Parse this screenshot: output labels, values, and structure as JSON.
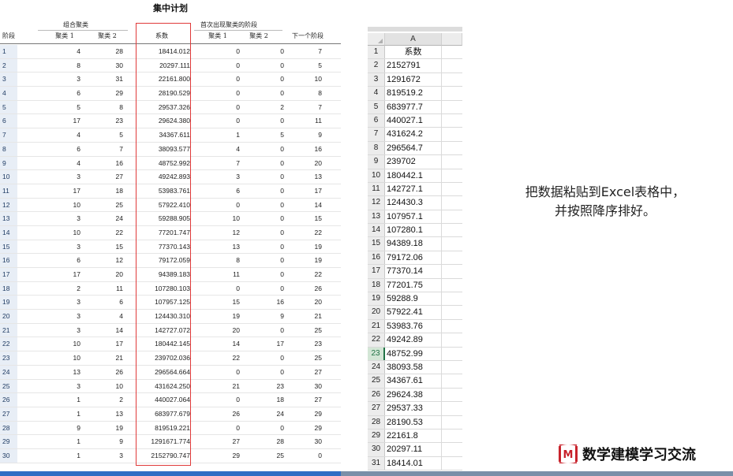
{
  "spss": {
    "title": "集中计划",
    "group_combined": "组合聚类",
    "group_first_appear": "首次出现聚类的阶段",
    "headers": {
      "stage": "阶段",
      "cluster1": "聚类 1",
      "cluster2": "聚类 2",
      "coefficient": "系数",
      "first_cluster1": "聚类 1",
      "first_cluster2": "聚类 2",
      "next_stage": "下一个阶段"
    },
    "rows": [
      [
        "1",
        "4",
        "28",
        "18414.012",
        "0",
        "0",
        "7"
      ],
      [
        "2",
        "8",
        "30",
        "20297.111",
        "0",
        "0",
        "5"
      ],
      [
        "3",
        "3",
        "31",
        "22161.800",
        "0",
        "0",
        "10"
      ],
      [
        "4",
        "6",
        "29",
        "28190.529",
        "0",
        "0",
        "8"
      ],
      [
        "5",
        "5",
        "8",
        "29537.326",
        "0",
        "2",
        "7"
      ],
      [
        "6",
        "17",
        "23",
        "29624.380",
        "0",
        "0",
        "11"
      ],
      [
        "7",
        "4",
        "5",
        "34367.611",
        "1",
        "5",
        "9"
      ],
      [
        "8",
        "6",
        "7",
        "38093.577",
        "4",
        "0",
        "16"
      ],
      [
        "9",
        "4",
        "16",
        "48752.992",
        "7",
        "0",
        "20"
      ],
      [
        "10",
        "3",
        "27",
        "49242.893",
        "3",
        "0",
        "13"
      ],
      [
        "11",
        "17",
        "18",
        "53983.761",
        "6",
        "0",
        "17"
      ],
      [
        "12",
        "10",
        "25",
        "57922.410",
        "0",
        "0",
        "14"
      ],
      [
        "13",
        "3",
        "24",
        "59288.905",
        "10",
        "0",
        "15"
      ],
      [
        "14",
        "10",
        "22",
        "77201.747",
        "12",
        "0",
        "22"
      ],
      [
        "15",
        "3",
        "15",
        "77370.143",
        "13",
        "0",
        "19"
      ],
      [
        "16",
        "6",
        "12",
        "79172.059",
        "8",
        "0",
        "19"
      ],
      [
        "17",
        "17",
        "20",
        "94389.183",
        "11",
        "0",
        "22"
      ],
      [
        "18",
        "2",
        "11",
        "107280.103",
        "0",
        "0",
        "26"
      ],
      [
        "19",
        "3",
        "6",
        "107957.125",
        "15",
        "16",
        "20"
      ],
      [
        "20",
        "3",
        "4",
        "124430.310",
        "19",
        "9",
        "21"
      ],
      [
        "21",
        "3",
        "14",
        "142727.072",
        "20",
        "0",
        "25"
      ],
      [
        "22",
        "10",
        "17",
        "180442.145",
        "14",
        "17",
        "23"
      ],
      [
        "23",
        "10",
        "21",
        "239702.036",
        "22",
        "0",
        "25"
      ],
      [
        "24",
        "13",
        "26",
        "296564.664",
        "0",
        "0",
        "27"
      ],
      [
        "25",
        "3",
        "10",
        "431624.250",
        "21",
        "23",
        "30"
      ],
      [
        "26",
        "1",
        "2",
        "440027.064",
        "0",
        "18",
        "27"
      ],
      [
        "27",
        "1",
        "13",
        "683977.679",
        "26",
        "24",
        "29"
      ],
      [
        "28",
        "9",
        "19",
        "819519.221",
        "0",
        "0",
        "29"
      ],
      [
        "29",
        "1",
        "9",
        "1291671.774",
        "27",
        "28",
        "30"
      ],
      [
        "30",
        "1",
        "3",
        "2152790.747",
        "29",
        "25",
        "0"
      ]
    ]
  },
  "excel": {
    "col_a": "A",
    "selected_row": "23",
    "cells": [
      [
        "1",
        "系数"
      ],
      [
        "2",
        "2152791"
      ],
      [
        "3",
        "1291672"
      ],
      [
        "4",
        "819519.2"
      ],
      [
        "5",
        "683977.7"
      ],
      [
        "6",
        "440027.1"
      ],
      [
        "7",
        "431624.2"
      ],
      [
        "8",
        "296564.7"
      ],
      [
        "9",
        "239702"
      ],
      [
        "10",
        "180442.1"
      ],
      [
        "11",
        "142727.1"
      ],
      [
        "12",
        "124430.3"
      ],
      [
        "13",
        "107957.1"
      ],
      [
        "14",
        "107280.1"
      ],
      [
        "15",
        "94389.18"
      ],
      [
        "16",
        "79172.06"
      ],
      [
        "17",
        "77370.14"
      ],
      [
        "18",
        "77201.75"
      ],
      [
        "19",
        "59288.9"
      ],
      [
        "20",
        "57922.41"
      ],
      [
        "21",
        "53983.76"
      ],
      [
        "22",
        "49242.89"
      ],
      [
        "23",
        "48752.99"
      ],
      [
        "24",
        "38093.58"
      ],
      [
        "25",
        "34367.61"
      ],
      [
        "26",
        "29624.38"
      ],
      [
        "27",
        "29537.33"
      ],
      [
        "28",
        "28190.53"
      ],
      [
        "29",
        "22161.8"
      ],
      [
        "30",
        "20297.11"
      ],
      [
        "31",
        "18414.01"
      ]
    ]
  },
  "instruction": {
    "line1": "把数据粘贴到Excel表格中，",
    "line2": "并按照降序排好。"
  },
  "logo": {
    "mark": "M",
    "text": "数学建模学习交流"
  },
  "colors": {
    "highlight_box": "#e03a3a",
    "stage_cell_bg": "#e8eef6",
    "excel_selected": "#217346",
    "logo_red": "#c8232c"
  }
}
